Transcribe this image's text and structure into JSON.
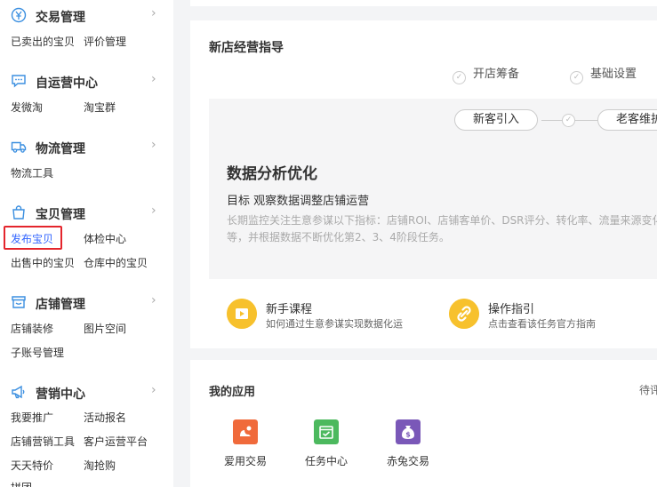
{
  "sidebar": {
    "sections": [
      {
        "title": "交易管理",
        "icon": "yen-circle-icon",
        "links": [
          "已卖出的宝贝",
          "评价管理"
        ]
      },
      {
        "title": "自运营中心",
        "icon": "chat-bubble-icon",
        "links": [
          "发微淘",
          "淘宝群"
        ]
      },
      {
        "title": "物流管理",
        "icon": "truck-icon",
        "links": [
          "物流工具"
        ]
      },
      {
        "title": "宝贝管理",
        "icon": "shopping-bag-icon",
        "links": [
          "发布宝贝",
          "体检中心",
          "出售中的宝贝",
          "仓库中的宝贝"
        ]
      },
      {
        "title": "店铺管理",
        "icon": "store-icon",
        "links": [
          "店铺装修",
          "图片空间",
          "子账号管理"
        ]
      },
      {
        "title": "营销中心",
        "icon": "megaphone-icon",
        "links": [
          "我要推广",
          "活动报名",
          "店铺营销工具",
          "客户运营平台",
          "天天特价",
          "淘抢购",
          "拼团"
        ]
      }
    ],
    "chevron": "›"
  },
  "guide": {
    "title": "新店经营指导",
    "steps": [
      "开店筹备",
      "基础设置"
    ],
    "pills": [
      "新客引入",
      "老客维护"
    ],
    "check": "✓",
    "panel_title": "数据分析优化",
    "goal": "目标 观察数据调整店铺运营",
    "desc": "长期监控关注生意参谋以下指标：店铺ROI、店铺客单价、DSR评分、转化率、流量来源变化等，并根据数据不断优化第2、3、4阶段任务。",
    "features": [
      {
        "title": "新手课程",
        "sub": "如何通过生意参谋实现数据化运",
        "icon": "play-video-icon"
      },
      {
        "title": "操作指引",
        "sub": "点击查看该任务官方指南",
        "icon": "link-icon"
      }
    ]
  },
  "apps": {
    "title": "我的应用",
    "side": "待评",
    "items": [
      {
        "label": "爱用交易",
        "icon": "aiyong-icon",
        "color": "#f06a3b"
      },
      {
        "label": "任务中心",
        "icon": "task-center-icon",
        "color": "#4cb95e"
      },
      {
        "label": "赤兔交易",
        "icon": "money-bag-icon",
        "color": "#7a58b8"
      }
    ]
  },
  "colors": {
    "highlight_border": "#e4252c",
    "active_link": "#3366ff",
    "icon_blue": "#3b8fe0",
    "feature_yellow": "#f7c12d"
  }
}
